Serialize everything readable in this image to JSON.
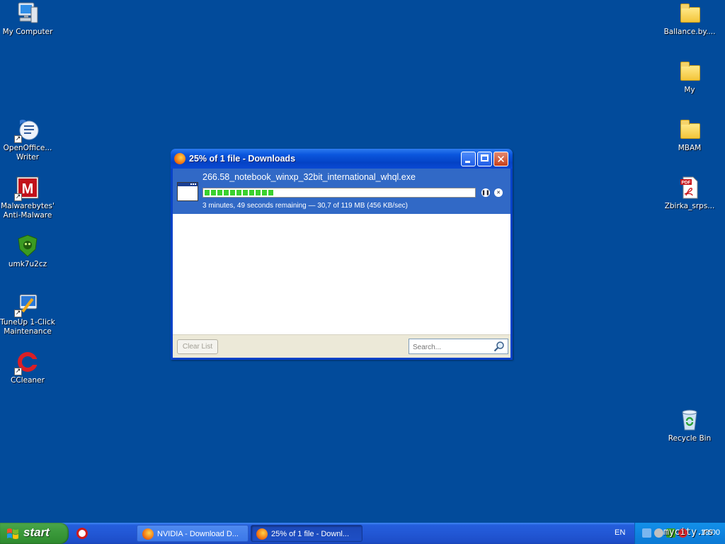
{
  "desktop": {
    "left_icons": [
      {
        "name": "my-computer",
        "label": "My Computer"
      },
      {
        "name": "openoffice-writer",
        "label": "OpenOffice...\nWriter"
      },
      {
        "name": "malwarebytes",
        "label": "Malwarebytes'\nAnti-Malware"
      },
      {
        "name": "umk7u2cz",
        "label": "umk7u2cz"
      },
      {
        "name": "tuneup",
        "label": "TuneUp 1-Click\nMaintenance"
      },
      {
        "name": "ccleaner",
        "label": "CCleaner"
      }
    ],
    "right_icons": [
      {
        "name": "ballance",
        "label": "Ballance.by...."
      },
      {
        "name": "my",
        "label": "My"
      },
      {
        "name": "mbam",
        "label": "MBAM"
      },
      {
        "name": "zbirka",
        "label": "Zbirka_srps..."
      },
      {
        "name": "recycle-bin",
        "label": "Recycle Bin"
      }
    ]
  },
  "downloads_window": {
    "title": "25% of 1 file - Downloads",
    "item": {
      "filename": "266.58_notebook_winxp_32bit_international_whql.exe",
      "progress_fraction": 0.26,
      "status": "3 minutes, 49 seconds remaining — 30,7 of 119 MB (456 KB/sec)"
    },
    "clear_list_label": "Clear List",
    "search_placeholder": "Search..."
  },
  "taskbar": {
    "start_label": "start",
    "tasks": [
      {
        "label": "NVIDIA - Download D...",
        "active": false
      },
      {
        "label": "25% of 1 file - Downl...",
        "active": true
      }
    ],
    "language": "EN",
    "clock": "18:00"
  },
  "watermark": "mycity.rs",
  "colors": {
    "desktop": "#024b9b",
    "selected_row": "#3169c6",
    "progress": "#3bd12e",
    "start_green": "#3c9b3c"
  }
}
